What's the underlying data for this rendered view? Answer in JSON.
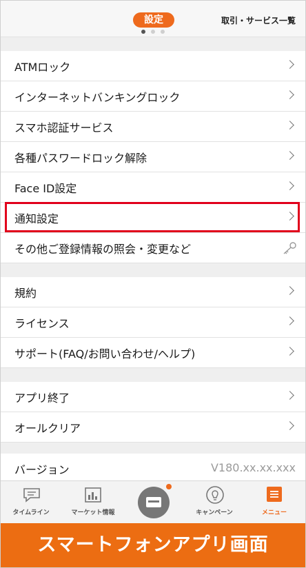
{
  "header": {
    "title": "設定",
    "right_link": "取引・サービス一覧",
    "page_indicator": {
      "total": 3,
      "active": 1
    }
  },
  "sections": [
    {
      "items": [
        {
          "label": "ATMロック",
          "trailing": "chevron"
        },
        {
          "label": "インターネットバンキングロック",
          "trailing": "chevron"
        },
        {
          "label": "スマホ認証サービス",
          "trailing": "chevron"
        },
        {
          "label": "各種パスワードロック解除",
          "trailing": "chevron"
        },
        {
          "label": "Face ID設定",
          "trailing": "chevron"
        },
        {
          "label": "通知設定",
          "trailing": "chevron",
          "highlighted": true
        },
        {
          "label": "その他ご登録情報の照会・変更など",
          "trailing": "key-icon"
        }
      ]
    },
    {
      "items": [
        {
          "label": "規約",
          "trailing": "chevron"
        },
        {
          "label": "ライセンス",
          "trailing": "chevron"
        },
        {
          "label": "サポート(FAQ/お問い合わせ/ヘルプ)",
          "trailing": "chevron"
        }
      ]
    },
    {
      "items": [
        {
          "label": "アプリ終了",
          "trailing": "chevron"
        },
        {
          "label": "オールクリア",
          "trailing": "chevron"
        }
      ]
    },
    {
      "items": [
        {
          "label": "バージョン",
          "value": "V180.xx.xx.xxx"
        }
      ]
    }
  ],
  "tabbar": {
    "tabs": [
      {
        "label": "タイムライン",
        "icon": "chat-icon"
      },
      {
        "label": "マーケット情報",
        "icon": "chart-icon"
      },
      {
        "label": "",
        "icon": "card-icon"
      },
      {
        "label": "キャンペーン",
        "icon": "lightbulb-icon"
      },
      {
        "label": "メニュー",
        "icon": "menu-icon",
        "active": true
      }
    ]
  },
  "banner": {
    "text": "スマートフォンアプリ画面"
  },
  "colors": {
    "accent": "#ee6a1d",
    "highlight": "#e1001b",
    "banner": "#ec6d12"
  }
}
